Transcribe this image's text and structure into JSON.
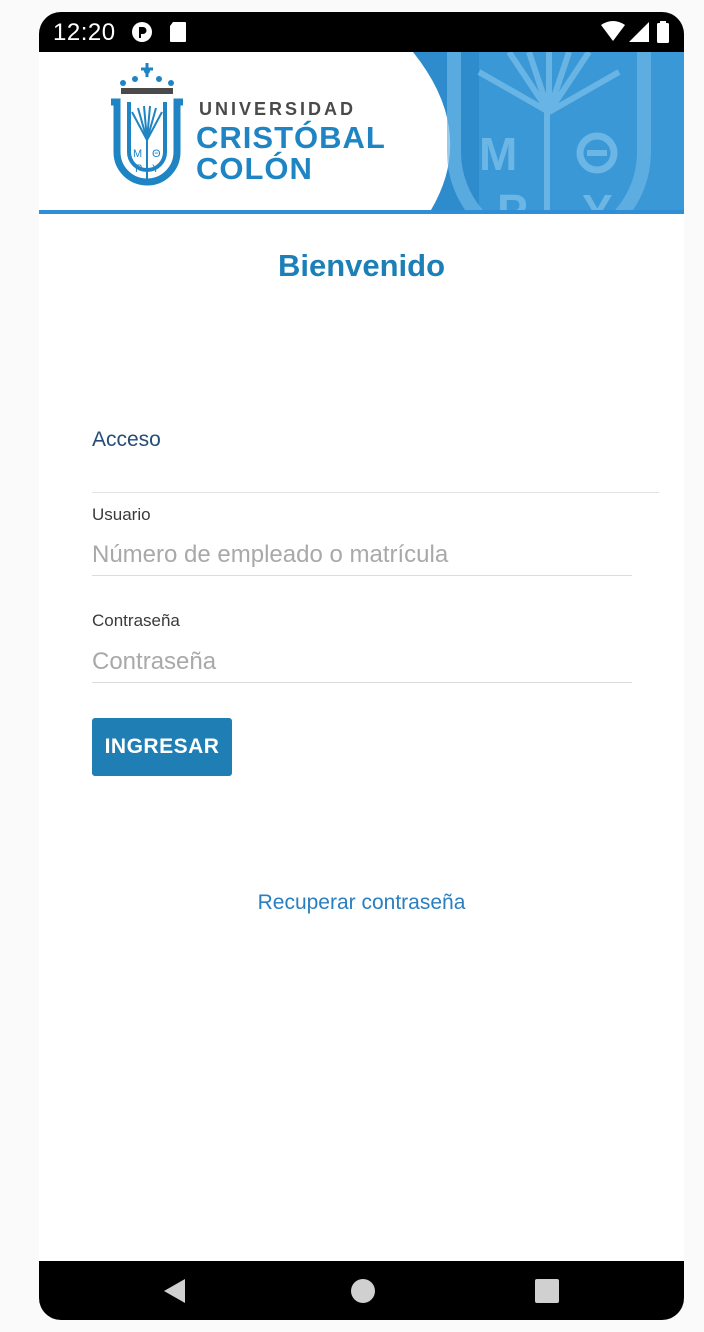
{
  "status_bar": {
    "time": "12:20",
    "icons": [
      "notification-circle-icon",
      "sd-card-icon",
      "wifi-icon",
      "signal-icon",
      "battery-icon"
    ]
  },
  "header": {
    "logo_line1": "UNIVERSIDAD",
    "logo_line2": "CRISTÓBAL",
    "logo_line3": "COLÓN",
    "crest_letters": "MΘPY",
    "accent_color": "#1f84c3"
  },
  "main": {
    "title": "Bienvenido",
    "section_label": "Acceso",
    "username": {
      "label": "Usuario",
      "placeholder": "Número de empleado o matrícula",
      "value": ""
    },
    "password": {
      "label": "Contraseña",
      "placeholder": "Contraseña",
      "value": ""
    },
    "submit_label": "INGRESAR",
    "recover_link": "Recuperar contraseña"
  },
  "nav_bar": {
    "buttons": [
      "back-icon",
      "home-icon",
      "recents-icon"
    ]
  }
}
